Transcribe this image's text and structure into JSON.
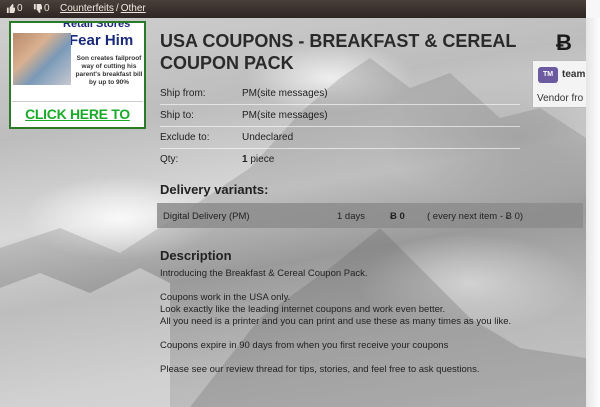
{
  "topbar": {
    "upvotes": "0",
    "downvotes": "0",
    "breadcrumb_1": "Counterfeits",
    "breadcrumb_sep": "/",
    "breadcrumb_2": "Other"
  },
  "ad": {
    "heading_top": "Retail Stores",
    "heading": "Fear Him",
    "blurb": "Son creates failproof way of cutting his parent's breakfast bill by up to 90%",
    "cta": "CLICK HERE TO SEE IT"
  },
  "listing": {
    "title": "USA COUPONS - BREAKFAST & CEREAL COUPON PACK",
    "currency_symbol": "Ƀ"
  },
  "vendor": {
    "badge": "TM",
    "name": "team",
    "label": "Vendor fro"
  },
  "info": {
    "ship_from_label": "Ship from:",
    "ship_from_value": "PM(site messages)",
    "ship_to_label": "Ship to:",
    "ship_to_value": "PM(site messages)",
    "exclude_label": "Exclude to:",
    "exclude_value": "Undeclared",
    "qty_label": "Qty:",
    "qty_value": "1",
    "qty_unit": "piece"
  },
  "delivery": {
    "heading": "Delivery variants:",
    "option": "Digital Delivery (PM)",
    "days": "1 days",
    "price": "Ƀ 0",
    "next": "( every next item - Ƀ 0)"
  },
  "description": {
    "heading": "Description",
    "line1": "Introducing the Breakfast & Cereal Coupon Pack.",
    "line2": "Coupons work in the USA only.",
    "line3": "Look exactly like the leading internet coupons and work even better.",
    "line4": "All you need is a printer and you can print and use these as many times as you like.",
    "line5": "Coupons expire in 90 days from when you first receive your coupons",
    "line6": "Please see our review thread for tips, stories, and feel free to ask questions."
  }
}
